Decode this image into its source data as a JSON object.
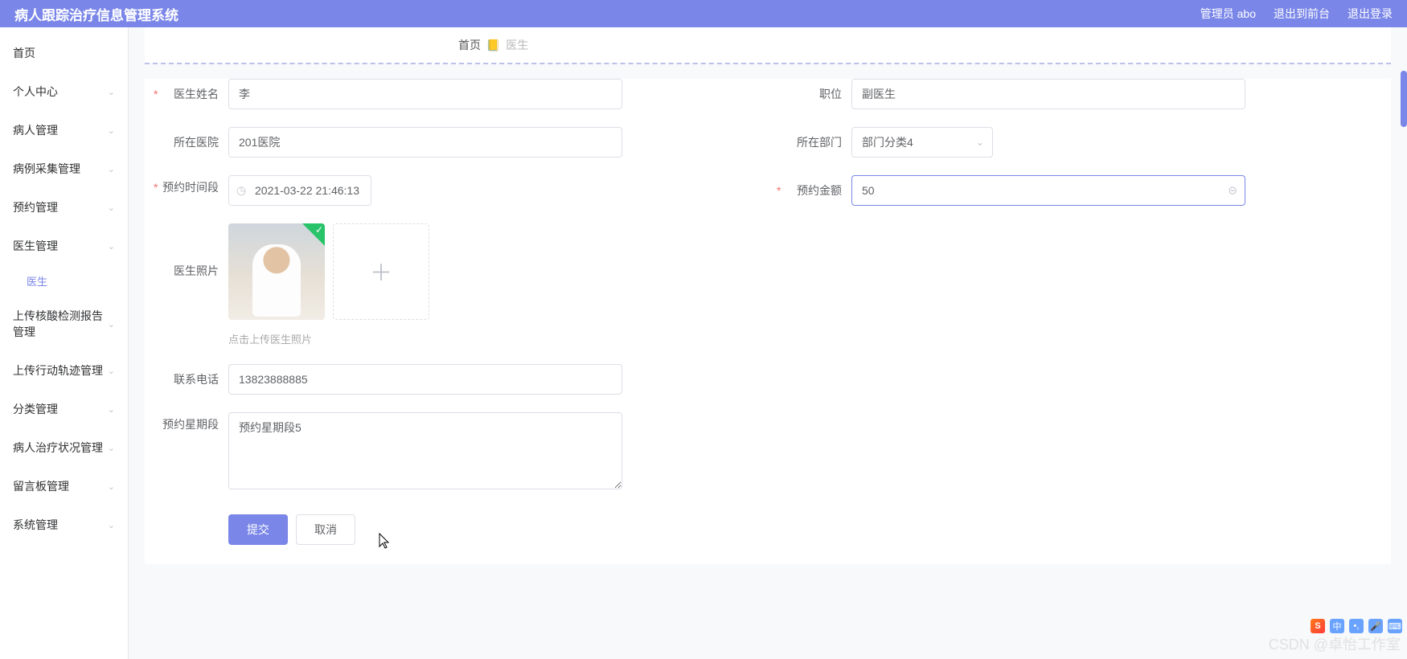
{
  "header": {
    "title": "病人跟踪治疗信息管理系统",
    "admin_label": "管理员 abo",
    "logout_front": "退出到前台",
    "logout": "退出登录"
  },
  "sidebar": {
    "items": [
      {
        "label": "首页",
        "has_children": false
      },
      {
        "label": "个人中心",
        "has_children": true
      },
      {
        "label": "病人管理",
        "has_children": true
      },
      {
        "label": "病例采集管理",
        "has_children": true
      },
      {
        "label": "预约管理",
        "has_children": true
      },
      {
        "label": "医生管理",
        "has_children": true,
        "sub": [
          {
            "label": "医生"
          }
        ]
      },
      {
        "label": "上传核酸检测报告管理",
        "has_children": true
      },
      {
        "label": "上传行动轨迹管理",
        "has_children": true
      },
      {
        "label": "分类管理",
        "has_children": true
      },
      {
        "label": "病人治疗状况管理",
        "has_children": true
      },
      {
        "label": "留言板管理",
        "has_children": true
      },
      {
        "label": "系统管理",
        "has_children": true
      }
    ]
  },
  "breadcrumb": {
    "home": "首页",
    "icon": "📒",
    "current": "医生"
  },
  "form": {
    "doctor_name": {
      "label": "医生姓名",
      "value": "李"
    },
    "position": {
      "label": "职位",
      "value": "副医生"
    },
    "hospital": {
      "label": "所在医院",
      "value": "201医院"
    },
    "department": {
      "label": "所在部门",
      "value": "部门分类4"
    },
    "appoint_time": {
      "label": "预约时间段",
      "value": "2021-03-22 21:46:13"
    },
    "appoint_fee": {
      "label": "预约金额",
      "value": "50"
    },
    "photo": {
      "label": "医生照片",
      "hint": "点击上传医生照片"
    },
    "phone": {
      "label": "联系电话",
      "value": "13823888885"
    },
    "appoint_week": {
      "label": "预约星期段",
      "value": "预约星期段5"
    },
    "submit_label": "提交",
    "cancel_label": "取消"
  },
  "watermark": "CSDN @卓怡工作室"
}
